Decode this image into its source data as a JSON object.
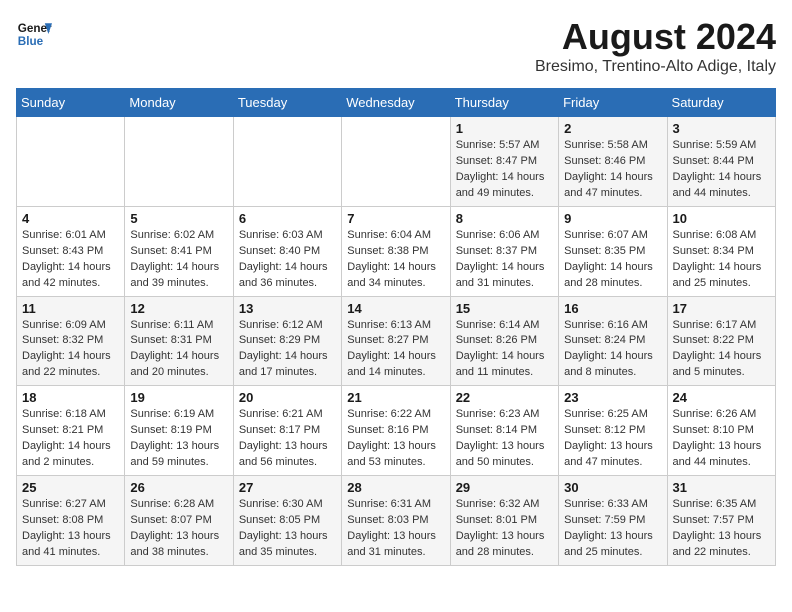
{
  "header": {
    "logo_line1": "General",
    "logo_line2": "Blue",
    "month_year": "August 2024",
    "location": "Bresimo, Trentino-Alto Adige, Italy"
  },
  "weekdays": [
    "Sunday",
    "Monday",
    "Tuesday",
    "Wednesday",
    "Thursday",
    "Friday",
    "Saturday"
  ],
  "weeks": [
    [
      {
        "day": "",
        "info": ""
      },
      {
        "day": "",
        "info": ""
      },
      {
        "day": "",
        "info": ""
      },
      {
        "day": "",
        "info": ""
      },
      {
        "day": "1",
        "info": "Sunrise: 5:57 AM\nSunset: 8:47 PM\nDaylight: 14 hours and 49 minutes."
      },
      {
        "day": "2",
        "info": "Sunrise: 5:58 AM\nSunset: 8:46 PM\nDaylight: 14 hours and 47 minutes."
      },
      {
        "day": "3",
        "info": "Sunrise: 5:59 AM\nSunset: 8:44 PM\nDaylight: 14 hours and 44 minutes."
      }
    ],
    [
      {
        "day": "4",
        "info": "Sunrise: 6:01 AM\nSunset: 8:43 PM\nDaylight: 14 hours and 42 minutes."
      },
      {
        "day": "5",
        "info": "Sunrise: 6:02 AM\nSunset: 8:41 PM\nDaylight: 14 hours and 39 minutes."
      },
      {
        "day": "6",
        "info": "Sunrise: 6:03 AM\nSunset: 8:40 PM\nDaylight: 14 hours and 36 minutes."
      },
      {
        "day": "7",
        "info": "Sunrise: 6:04 AM\nSunset: 8:38 PM\nDaylight: 14 hours and 34 minutes."
      },
      {
        "day": "8",
        "info": "Sunrise: 6:06 AM\nSunset: 8:37 PM\nDaylight: 14 hours and 31 minutes."
      },
      {
        "day": "9",
        "info": "Sunrise: 6:07 AM\nSunset: 8:35 PM\nDaylight: 14 hours and 28 minutes."
      },
      {
        "day": "10",
        "info": "Sunrise: 6:08 AM\nSunset: 8:34 PM\nDaylight: 14 hours and 25 minutes."
      }
    ],
    [
      {
        "day": "11",
        "info": "Sunrise: 6:09 AM\nSunset: 8:32 PM\nDaylight: 14 hours and 22 minutes."
      },
      {
        "day": "12",
        "info": "Sunrise: 6:11 AM\nSunset: 8:31 PM\nDaylight: 14 hours and 20 minutes."
      },
      {
        "day": "13",
        "info": "Sunrise: 6:12 AM\nSunset: 8:29 PM\nDaylight: 14 hours and 17 minutes."
      },
      {
        "day": "14",
        "info": "Sunrise: 6:13 AM\nSunset: 8:27 PM\nDaylight: 14 hours and 14 minutes."
      },
      {
        "day": "15",
        "info": "Sunrise: 6:14 AM\nSunset: 8:26 PM\nDaylight: 14 hours and 11 minutes."
      },
      {
        "day": "16",
        "info": "Sunrise: 6:16 AM\nSunset: 8:24 PM\nDaylight: 14 hours and 8 minutes."
      },
      {
        "day": "17",
        "info": "Sunrise: 6:17 AM\nSunset: 8:22 PM\nDaylight: 14 hours and 5 minutes."
      }
    ],
    [
      {
        "day": "18",
        "info": "Sunrise: 6:18 AM\nSunset: 8:21 PM\nDaylight: 14 hours and 2 minutes."
      },
      {
        "day": "19",
        "info": "Sunrise: 6:19 AM\nSunset: 8:19 PM\nDaylight: 13 hours and 59 minutes."
      },
      {
        "day": "20",
        "info": "Sunrise: 6:21 AM\nSunset: 8:17 PM\nDaylight: 13 hours and 56 minutes."
      },
      {
        "day": "21",
        "info": "Sunrise: 6:22 AM\nSunset: 8:16 PM\nDaylight: 13 hours and 53 minutes."
      },
      {
        "day": "22",
        "info": "Sunrise: 6:23 AM\nSunset: 8:14 PM\nDaylight: 13 hours and 50 minutes."
      },
      {
        "day": "23",
        "info": "Sunrise: 6:25 AM\nSunset: 8:12 PM\nDaylight: 13 hours and 47 minutes."
      },
      {
        "day": "24",
        "info": "Sunrise: 6:26 AM\nSunset: 8:10 PM\nDaylight: 13 hours and 44 minutes."
      }
    ],
    [
      {
        "day": "25",
        "info": "Sunrise: 6:27 AM\nSunset: 8:08 PM\nDaylight: 13 hours and 41 minutes."
      },
      {
        "day": "26",
        "info": "Sunrise: 6:28 AM\nSunset: 8:07 PM\nDaylight: 13 hours and 38 minutes."
      },
      {
        "day": "27",
        "info": "Sunrise: 6:30 AM\nSunset: 8:05 PM\nDaylight: 13 hours and 35 minutes."
      },
      {
        "day": "28",
        "info": "Sunrise: 6:31 AM\nSunset: 8:03 PM\nDaylight: 13 hours and 31 minutes."
      },
      {
        "day": "29",
        "info": "Sunrise: 6:32 AM\nSunset: 8:01 PM\nDaylight: 13 hours and 28 minutes."
      },
      {
        "day": "30",
        "info": "Sunrise: 6:33 AM\nSunset: 7:59 PM\nDaylight: 13 hours and 25 minutes."
      },
      {
        "day": "31",
        "info": "Sunrise: 6:35 AM\nSunset: 7:57 PM\nDaylight: 13 hours and 22 minutes."
      }
    ]
  ]
}
